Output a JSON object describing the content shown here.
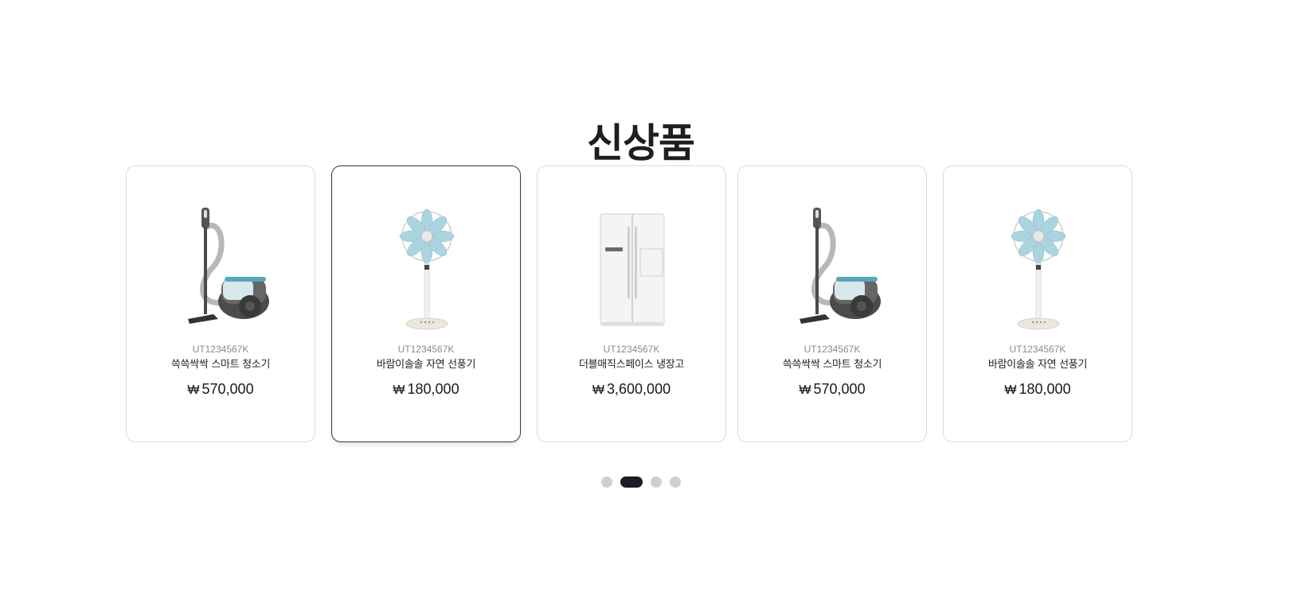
{
  "section": {
    "title": "신상품"
  },
  "products": [
    {
      "code": "UT1234567K",
      "name": "쓱쓱싹싹 스마트 청소기",
      "currency": "₩",
      "price": "570,000",
      "icon": "vacuum-cleaner-image"
    },
    {
      "code": "UT1234567K",
      "name": "바람이솔솔 자연 선풍기",
      "currency": "₩",
      "price": "180,000",
      "icon": "electric-fan-image"
    },
    {
      "code": "UT1234567K",
      "name": "더블매직스페이스 냉장고",
      "currency": "₩",
      "price": "3,600,000",
      "icon": "refrigerator-image"
    },
    {
      "code": "UT1234567K",
      "name": "쓱쓱싹싹 스마트 청소기",
      "currency": "₩",
      "price": "570,000",
      "icon": "vacuum-cleaner-image"
    },
    {
      "code": "UT1234567K",
      "name": "바람이솔솔 자연 선풍기",
      "currency": "₩",
      "price": "180,000",
      "icon": "electric-fan-image"
    }
  ],
  "pagination": {
    "total": 4,
    "active_index": 1
  },
  "colors": {
    "active_dot": "#1c1d24",
    "inactive_dot": "#cfcfcf",
    "card_border": "#dcdcdc",
    "active_card_border": "#3a3a3a",
    "fan_blade": "#a9d4e0",
    "vacuum_accent": "#5aa7b8"
  }
}
